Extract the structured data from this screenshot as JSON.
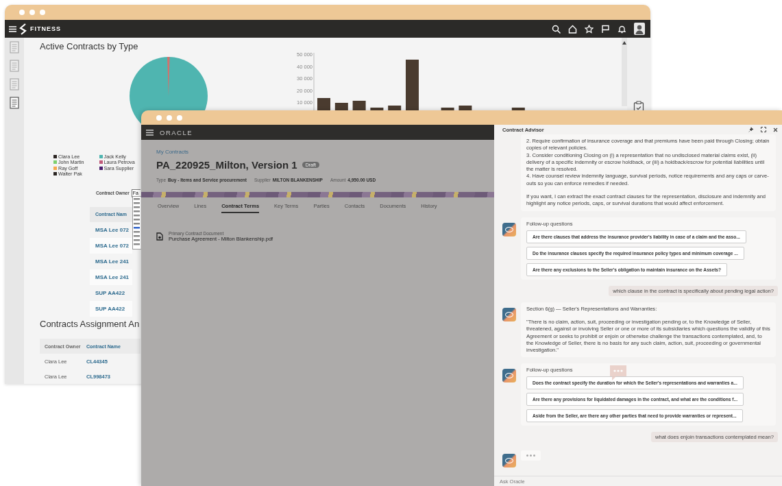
{
  "back_window": {
    "app_name": "FITNESS",
    "nav_icons": [
      {
        "selected": false
      },
      {
        "selected": false
      },
      {
        "selected": false
      },
      {
        "selected": true
      }
    ],
    "pie_title": "Active Contracts by Type",
    "legend": [
      {
        "label": "Clara Lee",
        "color": "#2b2522"
      },
      {
        "label": "John Martin",
        "color": "#7ccf6e"
      },
      {
        "label": "Ray Goff",
        "color": "#f5a94d"
      },
      {
        "label": "Walter Pak",
        "color": "#2b2522"
      },
      {
        "label": "Jack Kelly",
        "color": "#4fb5b0"
      },
      {
        "label": "Laura Petrova",
        "color": "#c05a7a"
      },
      {
        "label": "Sara Supplier",
        "color": "#4a1e6e"
      }
    ],
    "bar_chart": {
      "axis_labels": [
        "50 000",
        "40 000",
        "30 000",
        "20 000",
        "10 000"
      ]
    },
    "owner_filter": {
      "label": "Contract Owner",
      "value": "Fa"
    },
    "contracts_table": {
      "columns": [
        "Contract Nam"
      ],
      "rows": [
        "MSA Lee 072",
        "MSA Lee 072",
        "MSA Lee 241",
        "MSA Lee 241",
        "SUP AA422",
        "SUP AA422"
      ]
    },
    "assignment_title": "Contracts Assignment An",
    "assignment_table": {
      "columns": [
        "Contract Owner",
        "Contract Name"
      ],
      "rows": [
        [
          "Clara Lee",
          "CL44345"
        ],
        [
          "Clara Lee",
          "CL998473"
        ]
      ]
    }
  },
  "front_window": {
    "brand": "ORACLE",
    "breadcrumb": "My Contracts",
    "title": "PA_220925_Milton, Version 1",
    "status": "Draft",
    "meta": [
      {
        "label": "Type",
        "value": "Buy - Items and Service procurement"
      },
      {
        "label": "Supplier",
        "value": "MILTON BLANKENSHIP"
      },
      {
        "label": "Amount",
        "value": "4,950.00 USD"
      }
    ],
    "tabs": [
      {
        "label": "Overview",
        "selected": false
      },
      {
        "label": "Lines",
        "selected": false
      },
      {
        "label": "Contract Terms",
        "selected": true
      },
      {
        "label": "Key Terms",
        "selected": false
      },
      {
        "label": "Parties",
        "selected": false
      },
      {
        "label": "Contacts",
        "selected": false
      },
      {
        "label": "Documents",
        "selected": false
      },
      {
        "label": "History",
        "selected": false
      }
    ],
    "document": {
      "label": "Primary Contract Document",
      "file": "Purchase Agreement - Milton Blankenship.pdf"
    }
  },
  "advisor": {
    "title": "Contract Advisor",
    "messages": [
      {
        "kind": "answer",
        "avatar": false,
        "blocks": [
          [
            "2. Require confirmation of insurance coverage and that premiums have been paid through Closing; obtain copies of relevant policies.",
            "3. Consider conditioning Closing on (i) a representation that no undisclosed material claims exist, (ii) delivery of a specific indemnity or escrow holdback, or (iii) a holdback/escrow for potential liabilities until the matter is resolved.",
            "4. Have counsel review indemnity language, survival periods, notice requirements and any caps or carve-outs so you can enforce remedies if needed."
          ],
          [
            "If you want, I can extract the exact contract clauses for the representation, disclosure and indemnity and highlight any notice periods, caps, or survival durations that would affect enforcement."
          ]
        ]
      },
      {
        "kind": "followups",
        "heading": "Follow-up questions",
        "questions": [
          "Are there clauses that address the insurance provider's liability in case of a claim and the asso...",
          "Do the insurance clauses specify the required insurance policy types and minimum coverage ...",
          "Are there any exclusions to the Seller's obligation to maintain insurance on the Assets?"
        ]
      },
      {
        "kind": "user",
        "text": "which clause in the contract is specifically about pending legal action?"
      },
      {
        "kind": "answer",
        "avatar": true,
        "blocks": [
          [
            "Section 6(g) — Seller's Representations and Warranties:"
          ],
          [
            "\"There is no claim, action, suit, proceeding or investigation pending or, to the Knowledge of Seller, threatened, against or involving Seller or one or more of its subsidiaries which questions the validity of this Agreement or seeks to prohibit or enjoin or otherwise challenge the transactions contemplated, and, to the Knowledge of Seller, there is no basis for any such claim, action, suit, proceeding or governmental investigation.\""
          ]
        ]
      },
      {
        "kind": "followups",
        "heading": "Follow-up questions",
        "questions": [
          "Does the contract specify the duration for which the Seller's representations and warranties a...",
          "Are there any provisions for liquidated damages in the contract, and what are the conditions f...",
          "Aside from the Seller, are there any other parties that need to provide warranties or represent..."
        ]
      },
      {
        "kind": "user",
        "text": "what does enjoin transactions contemplated mean?"
      },
      {
        "kind": "typing"
      }
    ],
    "input": {
      "placeholder": "Ask Oracle"
    }
  }
}
